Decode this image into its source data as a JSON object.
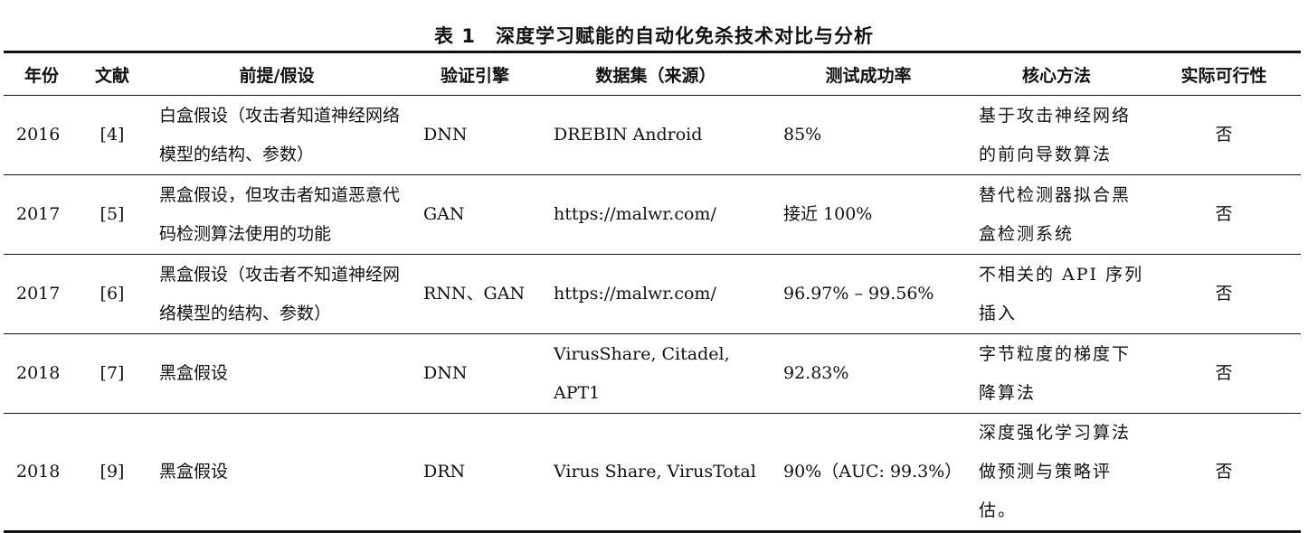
{
  "caption": {
    "number": "表 1",
    "title": "深度学习赋能的自动化免杀技术对比与分析"
  },
  "headers": [
    "年份",
    "文献",
    "前提/假设",
    "验证引擎",
    "数据集（来源）",
    "测试成功率",
    "核心方法",
    "实际可行性"
  ],
  "rows": [
    {
      "year": "2016",
      "ref": "[4]",
      "assumption": "白盒假设（攻击者知道神经网络模型的结构、参数）",
      "engine": "DNN",
      "dataset": "DREBIN Android",
      "rate": "85%",
      "method": "基于攻击神经网络的前向导数算法",
      "feasible": "否"
    },
    {
      "year": "2017",
      "ref": "[5]",
      "assumption": "黑盒假设，但攻击者知道恶意代码检测算法使用的功能",
      "engine": "GAN",
      "dataset": "https://malwr.com/",
      "rate": "接近 100%",
      "method": "替代检测器拟合黑盒检测系统",
      "feasible": "否"
    },
    {
      "year": "2017",
      "ref": "[6]",
      "assumption": "黑盒假设（攻击者不知道神经网络模型的结构、参数）",
      "engine": "RNN、GAN",
      "dataset": "https://malwr.com/",
      "rate": "96.97% – 99.56%",
      "method": "不相关的 API 序列插入",
      "feasible": "否"
    },
    {
      "year": "2018",
      "ref": "[7]",
      "assumption": "黑盒假设",
      "engine": "DNN",
      "dataset": "VirusShare, Citadel, APT1",
      "rate": "92.83%",
      "method": "字节粒度的梯度下降算法",
      "feasible": "否"
    },
    {
      "year": "2018",
      "ref": "[9]",
      "assumption": "黑盒假设",
      "engine": "DRN",
      "dataset": "Virus Share, VirusTotal",
      "rate": "90%（AUC: 99.3%）",
      "method": "深度强化学习算法做预测与策略评估。",
      "feasible": "否"
    }
  ]
}
